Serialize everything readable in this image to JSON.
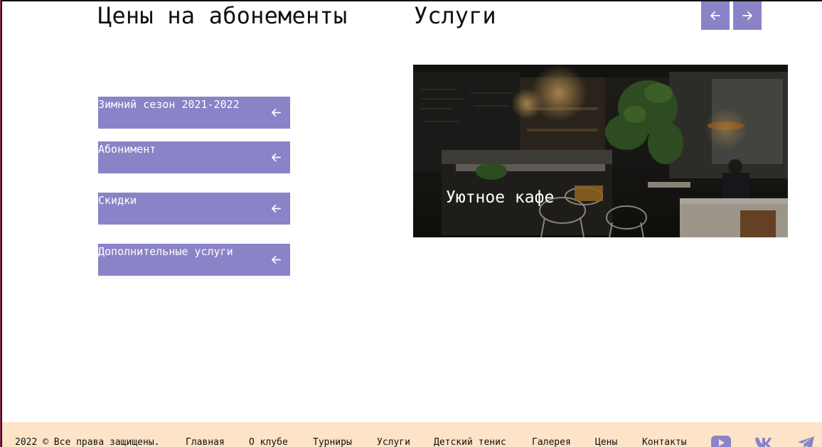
{
  "headings": {
    "prices": "Цены на абонементы",
    "services": "Услуги"
  },
  "slider": {
    "prev_icon": "arrow-left-icon",
    "next_icon": "arrow-right-icon",
    "slide": {
      "caption": "Уютное кафе"
    }
  },
  "prices_menu": {
    "items": [
      {
        "label": "Зимний сезон 2021-2022",
        "icon": "arrow-left-icon"
      },
      {
        "label": "Абонимент",
        "icon": "arrow-left-icon"
      },
      {
        "label": "Скидки",
        "icon": "arrow-left-icon"
      },
      {
        "label": "Дополнительные услуги",
        "icon": "arrow-left-icon"
      }
    ]
  },
  "footer": {
    "copyright": "2022 © Все права защищены.",
    "nav": [
      "Главная",
      "О клубе",
      "Турниры",
      "Услуги",
      "Детский тенис",
      "Галерея",
      "Цены",
      "Контакты"
    ],
    "social": [
      "youtube-icon",
      "vk-icon",
      "telegram-icon"
    ]
  },
  "colors": {
    "accent": "#8b83c7",
    "footer_bg": "#fde3c8",
    "text": "#111111"
  }
}
